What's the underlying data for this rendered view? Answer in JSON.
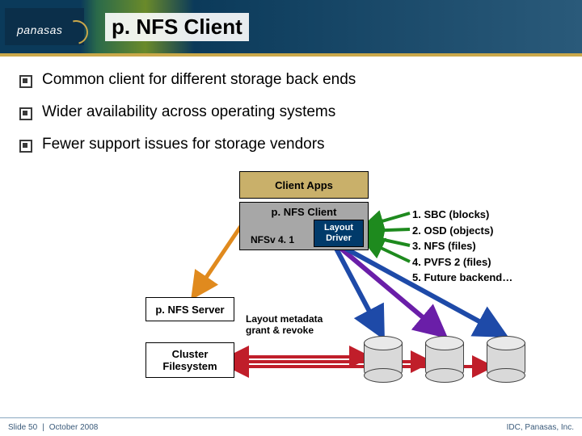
{
  "brand": {
    "name": "panasas"
  },
  "title": "p. NFS Client",
  "bullets": [
    "Common client for different storage back ends",
    "Wider availability across operating systems",
    "Fewer support issues for storage vendors"
  ],
  "boxes": {
    "client_apps": "Client Apps",
    "pnfs_client": "p. NFS Client",
    "nfsv": "NFSv 4. 1",
    "layout_driver": "Layout\nDriver",
    "pnfs_server": "p. NFS Server",
    "cluster_fs": "Cluster\nFilesystem",
    "meta_label": "Layout metadata\ngrant & revoke"
  },
  "backend_list": [
    "1. SBC (blocks)",
    "2. OSD (objects)",
    "3. NFS (files)",
    "4. PVFS 2 (files)",
    "5. Future backend…"
  ],
  "footer": {
    "slide": "Slide 50",
    "sep": "|",
    "date": "October 2008",
    "right": "IDC, Panasas, Inc."
  },
  "colors": {
    "khaki": "#c9b06a",
    "grey": "#a7a7a7",
    "navy": "#003a6a",
    "green": "#1e8a1e",
    "orange": "#e08a1e",
    "blue": "#1e4aa8",
    "purple": "#6a1ea8",
    "red": "#c01e2a"
  }
}
